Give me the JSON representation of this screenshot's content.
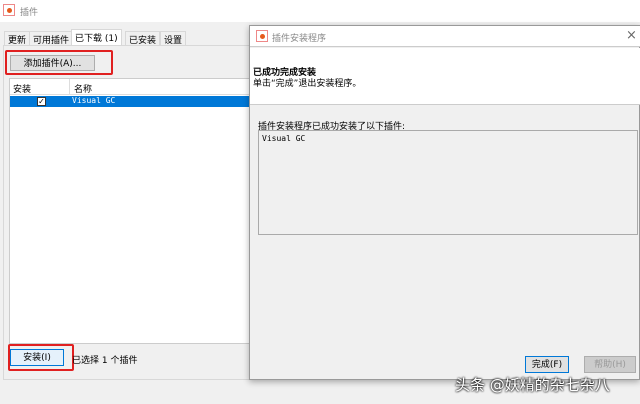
{
  "window": {
    "title": "插件"
  },
  "tabs": [
    {
      "label": "更新"
    },
    {
      "label": "可用插件"
    },
    {
      "label": "已下载 (1)"
    },
    {
      "label": "已安装"
    },
    {
      "label": "设置"
    }
  ],
  "add_button": "添加插件(A)...",
  "table": {
    "headers": [
      "安装",
      "名称"
    ],
    "rows": [
      {
        "checked": true,
        "name": "Visual GC"
      }
    ]
  },
  "install_button": "安装(I)",
  "selection_status": "已选择 1 个插件",
  "dialog": {
    "title": "插件安装程序",
    "heading": "已成功完成安装",
    "subheading": "单击“完成”退出安装程序。",
    "list_label": "插件安装程序已成功安装了以下插件:",
    "installed": "Visual GC",
    "finish_button": "完成(F)",
    "help_button": "帮助(H)",
    "close_icon": "×"
  },
  "watermark": "头条 @妖精的杂七杂八",
  "colors": {
    "selection": "#0078d7",
    "highlight": "#e02020"
  }
}
